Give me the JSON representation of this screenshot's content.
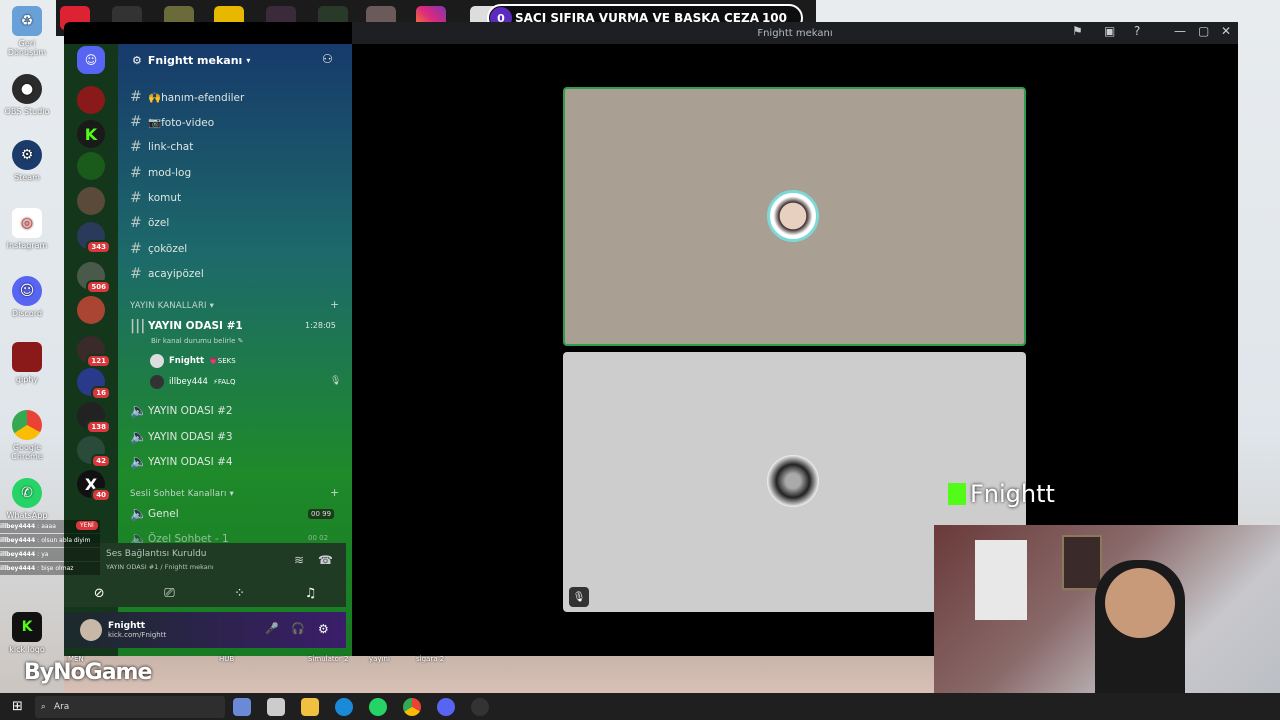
{
  "ticker": {
    "left": "0",
    "title": "SAÇI SIFIRA VURMA VE BAŞKA CEZA",
    "right": "100"
  },
  "window": {
    "title": "Fnightt mekanı"
  },
  "desktop_icons": [
    {
      "label": "Geri Dönüşüm",
      "icon": "recycle-bin-icon",
      "color": "#6aa0d8"
    },
    {
      "label": "OBS Studio",
      "icon": "obs-icon",
      "color": "#2b2b2b"
    },
    {
      "label": "Steam",
      "icon": "steam-icon",
      "color": "#1b3b6a"
    },
    {
      "label": "Instagram",
      "icon": "instagram-icon",
      "color": "#ffffff"
    },
    {
      "label": "Discord",
      "icon": "discord-icon",
      "color": "#5865f2"
    },
    {
      "label": "giphy",
      "icon": "giphy-icon",
      "color": "#8a1a1a"
    },
    {
      "label": "Google Chrome",
      "icon": "chrome-icon",
      "color": "#ffffff"
    },
    {
      "label": "WhatsApp",
      "icon": "whatsapp-icon",
      "color": "#25d366"
    },
    {
      "label": "kick logo",
      "icon": "kick-icon",
      "color": "#111111"
    }
  ],
  "server": {
    "name": "Fnightt mekanı"
  },
  "channels": [
    {
      "name": "🙌hanım-efendiler"
    },
    {
      "name": "📷foto-video"
    },
    {
      "name": "link-chat"
    },
    {
      "name": "mod-log"
    },
    {
      "name": "komut"
    },
    {
      "name": "özel"
    },
    {
      "name": "çoközel"
    },
    {
      "name": "acayipözel"
    }
  ],
  "category_streams": "YAYIN KANALLARI",
  "active_voice": {
    "name": "YAYIN ODASI #1",
    "timer": "1:28:05",
    "status": "Bir kanal durumu belirle"
  },
  "voice_users": [
    {
      "name": "Fnightt",
      "tag": "💗SEKS"
    },
    {
      "name": "illbey444",
      "tag": "⚡FALQ"
    }
  ],
  "voice_channels": [
    "YAYIN ODASI #2",
    "YAYIN ODASI #3",
    "YAYIN ODASI #4"
  ],
  "category_chat": "Sesli Sohbet Kanalları",
  "chat_voice": {
    "name": "Genel",
    "left": "00",
    "right": "99"
  },
  "chat_voice_2": {
    "name": "Özel Sohbet - 1",
    "left": "00",
    "right": "02"
  },
  "connection": {
    "status": "Ses Bağlantısı Kuruldu",
    "detail": "YAYIN ODASI #1 / Fnightt mekanı"
  },
  "user": {
    "name": "Fnightt",
    "sub": "kick.com/Fnightt"
  },
  "server_badges": [
    "343",
    "506",
    "121",
    "16",
    "138",
    "42",
    "40"
  ],
  "chat_log": [
    {
      "user": "illbey4444",
      "msg": "aaaa"
    },
    {
      "user": "illbey4444",
      "msg": "olsun abla diyim"
    },
    {
      "user": "illbey4444",
      "msg": "ya"
    },
    {
      "user": "illbey4444",
      "msg": "bişe olmaz"
    }
  ],
  "new_label": "YENİ",
  "brand_text": "Fnightt",
  "bynogame": "ByNoGame",
  "taskbar": {
    "search": "Ara"
  },
  "bottom_labels": [
    "MEN",
    "HUB",
    "Simulator 2",
    "yayını",
    "sigara 2"
  ]
}
